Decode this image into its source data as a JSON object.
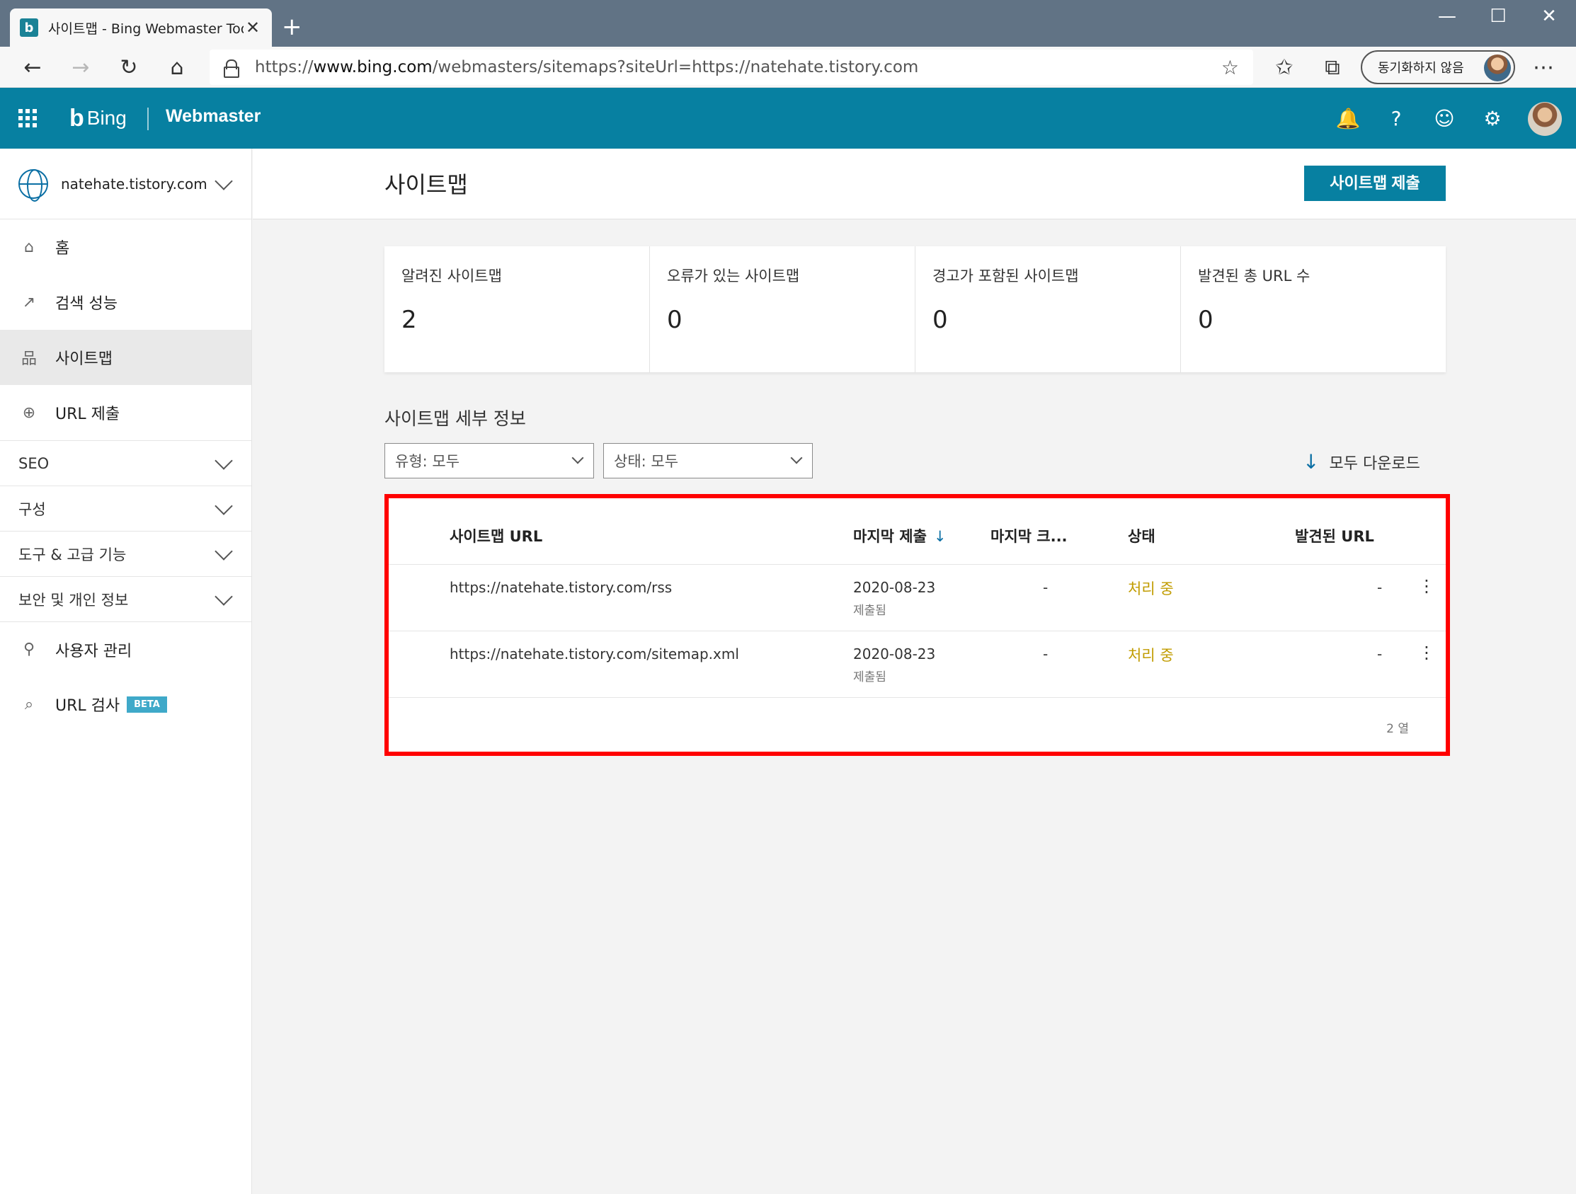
{
  "browser": {
    "tab_title": "사이트맵 - Bing Webmaster Tool",
    "tab_favicon": "b",
    "new_tab": "+",
    "url_prefix": "https://",
    "url_host": "www.bing.com",
    "url_path": "/webmasters/sitemaps?siteUrl=https://natehate.tistory.com",
    "sync_label": "동기화하지 않음",
    "icons": {
      "back": "←",
      "forward": "→",
      "refresh": "↻",
      "home": "⌂",
      "star": "☆",
      "favorites": "✩",
      "collections": "⧉",
      "more": "⋯",
      "minimize": "—",
      "maximize": "☐",
      "close": "✕",
      "tab_close": "✕"
    }
  },
  "header": {
    "brand_b": "b",
    "brand_name": "Bing",
    "product": "Webmaster",
    "icons": {
      "bell": "🔔",
      "help": "?",
      "feedback": "☺",
      "settings": "⚙"
    }
  },
  "sidebar": {
    "site": "natehate.tistory.com",
    "items": [
      {
        "label": "홈",
        "icon": "⌂"
      },
      {
        "label": "검색 성능",
        "icon": "↗"
      },
      {
        "label": "사이트맵",
        "icon": "品"
      },
      {
        "label": "URL 제출",
        "icon": "⊕"
      }
    ],
    "sections": [
      {
        "label": "SEO"
      },
      {
        "label": "구성"
      },
      {
        "label": "도구 & 고급 기능"
      },
      {
        "label": "보안 및 개인 정보"
      }
    ],
    "bottom_items": [
      {
        "label": "사용자 관리",
        "icon": "⚲"
      },
      {
        "label": "URL 검사",
        "icon": "⌕",
        "badge": "BETA"
      }
    ]
  },
  "main": {
    "title": "사이트맵",
    "submit_button": "사이트맵 제출",
    "stats": [
      {
        "label": "알려진 사이트맵",
        "value": "2"
      },
      {
        "label": "오류가 있는 사이트맵",
        "value": "0"
      },
      {
        "label": "경고가 포함된 사이트맵",
        "value": "0"
      },
      {
        "label": "발견된 총 URL 수",
        "value": "0"
      }
    ],
    "details_title": "사이트맵 세부 정보",
    "filter_type": "유형: 모두",
    "filter_status": "상태: 모두",
    "download_all": "모두 다운로드",
    "download_icon": "↓",
    "table": {
      "columns": [
        "사이트맵 URL",
        "마지막 제출",
        "마지막 크...",
        "상태",
        "발견된 URL"
      ],
      "sort_icon": "↓",
      "rows": [
        {
          "url": "https://natehate.tistory.com/rss",
          "date": "2020-08-23",
          "date_sub": "제출됨",
          "crawl": "-",
          "status": "처리 중",
          "found": "-",
          "more": "⋮"
        },
        {
          "url": "https://natehate.tistory.com/sitemap.xml",
          "date": "2020-08-23",
          "date_sub": "제출됨",
          "crawl": "-",
          "status": "처리 중",
          "found": "-",
          "more": "⋮"
        }
      ],
      "row_count": "2 열"
    }
  },
  "colors": {
    "brand": "#0780a1",
    "status_processing": "#c19c00",
    "highlight_border": "#ff0000"
  }
}
